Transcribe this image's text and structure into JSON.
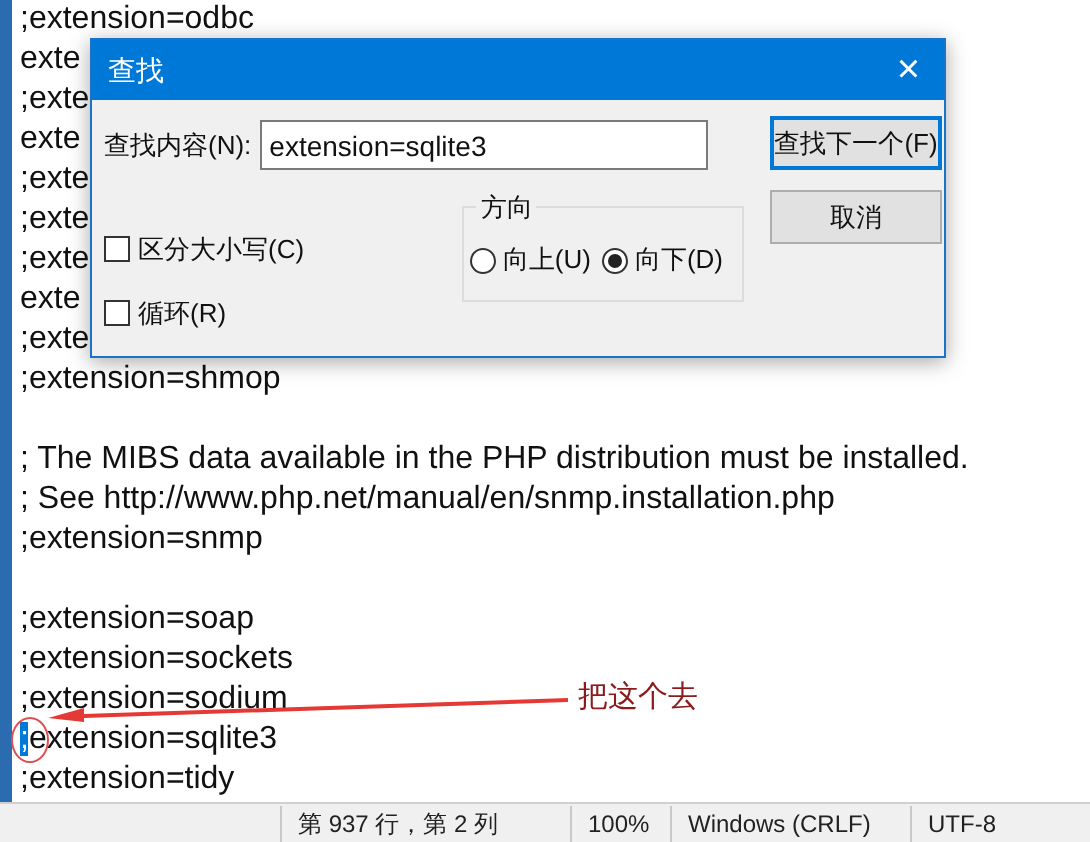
{
  "editor": {
    "lines": [
      {
        "kind": "text",
        "text": ";extension=odbc"
      },
      {
        "kind": "text",
        "text": "exte"
      },
      {
        "kind": "text",
        "text": ";exte"
      },
      {
        "kind": "text",
        "text": "exte"
      },
      {
        "kind": "text",
        "text": ";exte"
      },
      {
        "kind": "text",
        "text": ";exte"
      },
      {
        "kind": "text",
        "text": ";exte"
      },
      {
        "kind": "text",
        "text": "exte"
      },
      {
        "kind": "text",
        "text": ";exte"
      },
      {
        "kind": "text",
        "text": ";extension=shmop"
      },
      {
        "kind": "blank"
      },
      {
        "kind": "text",
        "text": "; The MIBS data available in the PHP distribution must be installed."
      },
      {
        "kind": "text",
        "text": "; See http://www.php.net/manual/en/snmp.installation.php"
      },
      {
        "kind": "text",
        "text": ";extension=snmp"
      },
      {
        "kind": "blank"
      },
      {
        "kind": "text",
        "text": ";extension=soap"
      },
      {
        "kind": "text",
        "text": ";extension=sockets"
      },
      {
        "kind": "text",
        "text": ";extension=sodium"
      },
      {
        "kind": "text",
        "text": ";extension=sqlite3",
        "first_char_selected": true
      },
      {
        "kind": "text",
        "text": ";extension=tidy"
      }
    ]
  },
  "find_dialog": {
    "title": "查找",
    "close": "×",
    "find_label": "查找内容(N):",
    "find_value": "extension=sqlite3",
    "buttons": [
      {
        "label": "查找下一个(F)",
        "focused": true
      },
      {
        "label": "取消",
        "focused": false
      }
    ],
    "direction": {
      "title": "方向",
      "options": [
        {
          "label": "向上(U)",
          "selected": false
        },
        {
          "label": "向下(D)",
          "selected": true
        }
      ]
    },
    "options": [
      {
        "label": "区分大小写(C)",
        "checked": false
      },
      {
        "label": "循环(R)",
        "checked": false
      }
    ]
  },
  "annotation": {
    "text": "把这个去"
  },
  "status_bar": [
    "第 937 行，第 2 列",
    "100%",
    "Windows (CRLF)",
    "UTF-8"
  ]
}
